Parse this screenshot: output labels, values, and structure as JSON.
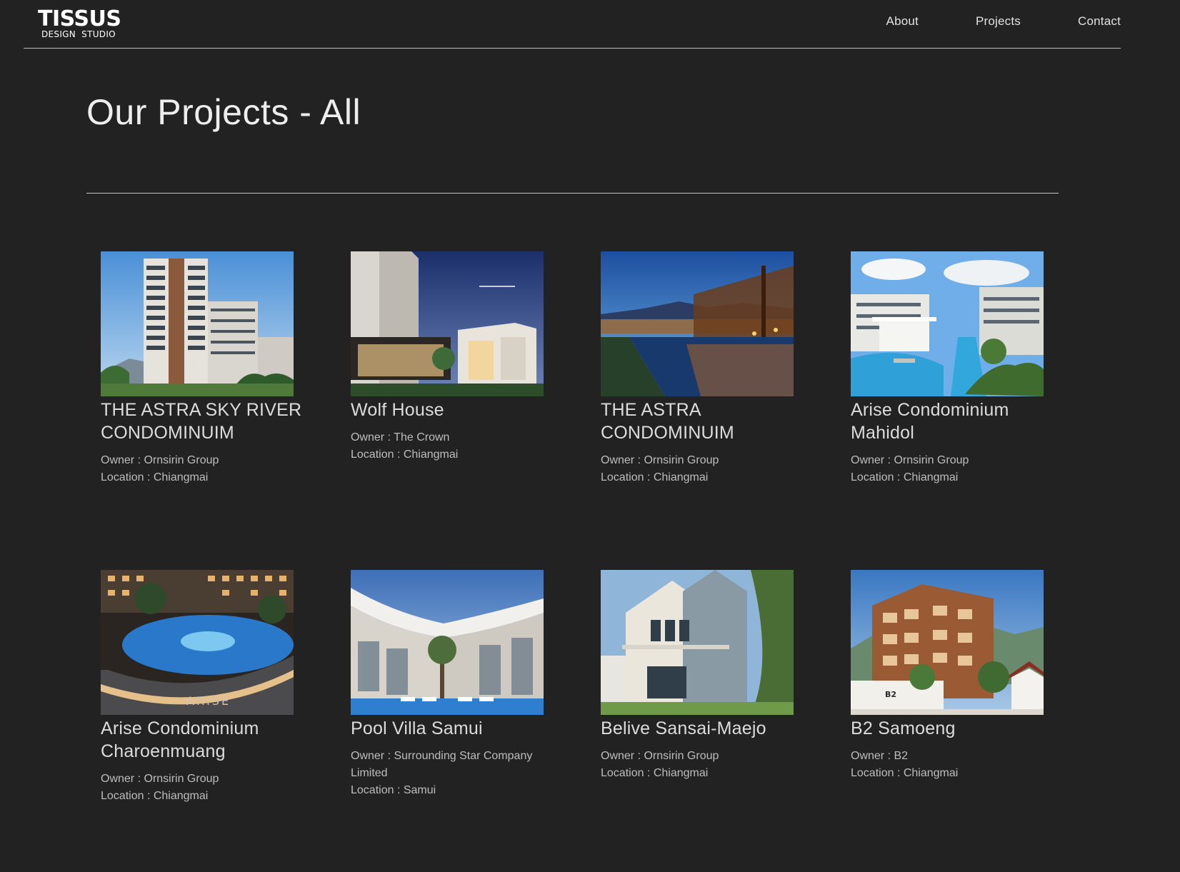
{
  "header": {
    "logo_main": "TISSUS",
    "logo_sub": "DESIGN STUDIO",
    "nav": [
      {
        "label": "About"
      },
      {
        "label": "Projects"
      },
      {
        "label": "Contact"
      }
    ]
  },
  "main": {
    "title": "Our Projects - All"
  },
  "labels": {
    "owner": "Owner : ",
    "location": "Location : "
  },
  "projects": [
    {
      "title": "THE ASTRA SKY RIVER CONDOMINUIM",
      "owner": "Ornsirin Group",
      "location": "Chiangmai"
    },
    {
      "title": "Wolf House",
      "owner": "The Crown",
      "location": "Chiangmai"
    },
    {
      "title": "THE ASTRA CONDOMINUIM",
      "owner": "Ornsirin Group",
      "location": "Chiangmai"
    },
    {
      "title": "Arise Condominium Mahidol",
      "owner": "Ornsirin Group",
      "location": "Chiangmai"
    },
    {
      "title": "Arise Condominium Charoenmuang",
      "owner": "Ornsirin Group",
      "location": "Chiangmai"
    },
    {
      "title": "Pool Villa Samui",
      "owner": "Surrounding Star Company Limited",
      "location": "Samui"
    },
    {
      "title": "Belive Sansai-Maejo",
      "owner": "Ornsirin Group",
      "location": "Chiangmai"
    },
    {
      "title": "B2 Samoeng",
      "owner": "B2",
      "location": "Chiangmai"
    }
  ],
  "image_text": {
    "arise_sign": "ARISE",
    "b2_sign": "B2"
  },
  "colors": {
    "background": "#222222",
    "text": "#d8d8d8",
    "rule": "#c4c4c4"
  }
}
